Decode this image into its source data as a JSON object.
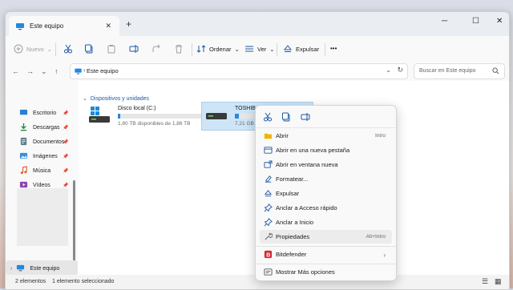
{
  "window": {
    "tab_title": "Este equipo",
    "new_tab": "+",
    "close_tab": "✕",
    "minimize": "─",
    "maximize": "☐",
    "close": "✕"
  },
  "toolbar": {
    "new_label": "Nuevo",
    "sort_label": "Ordenar",
    "view_label": "Ver",
    "eject_label": "Expulsar",
    "more_label": "•••"
  },
  "address": {
    "path": "Este equipo",
    "search_placeholder": "Buscar en Este equipo"
  },
  "sidebar": {
    "items": [
      {
        "label": "Escritorio",
        "icon": "desktop-icon"
      },
      {
        "label": "Descargas",
        "icon": "download-icon"
      },
      {
        "label": "Documentos",
        "icon": "document-icon"
      },
      {
        "label": "Imágenes",
        "icon": "image-icon"
      },
      {
        "label": "Música",
        "icon": "music-icon"
      },
      {
        "label": "Vídeos",
        "icon": "video-icon"
      }
    ],
    "this_pc": "Este equipo"
  },
  "main": {
    "section_title": "Dispositivos y unidades",
    "drives": [
      {
        "name": "Disco local (C:)",
        "free": "1,80 TB disponibles de 1,86 TB",
        "used_fraction": 0.03
      },
      {
        "name": "TOSHIBA (D:)",
        "free": "7,21 GB disponibles",
        "used_fraction": 0.05
      }
    ]
  },
  "status": {
    "count": "2 elementos",
    "selected": "1 elemento seleccionado"
  },
  "context_menu": {
    "items": [
      {
        "label": "Abrir",
        "shortcut": "Intro",
        "icon": "folder-icon"
      },
      {
        "label": "Abrir en una nueva pestaña",
        "shortcut": "",
        "icon": "new-tab-icon"
      },
      {
        "label": "Abrir en ventana nueva",
        "shortcut": "",
        "icon": "new-window-icon"
      },
      {
        "label": "Formatear...",
        "shortcut": "",
        "icon": "format-icon"
      },
      {
        "label": "Expulsar",
        "shortcut": "",
        "icon": "eject-icon"
      },
      {
        "label": "Anclar a Acceso rápido",
        "shortcut": "",
        "icon": "pin-icon"
      },
      {
        "label": "Anclar a Inicio",
        "shortcut": "",
        "icon": "pin-start-icon"
      },
      {
        "label": "Propiedades",
        "shortcut": "Alt+Intro",
        "icon": "wrench-icon"
      },
      {
        "label": "Bitdefender",
        "shortcut": "",
        "icon": "bitdefender-icon"
      },
      {
        "label": "Mostrar Más opciones",
        "shortcut": "",
        "icon": "more-options-icon"
      }
    ]
  },
  "colors": {
    "accent": "#0067c0",
    "selection": "#cde5f7",
    "drive_bar": "#2b88d8",
    "bitdefender": "#d9232e"
  }
}
